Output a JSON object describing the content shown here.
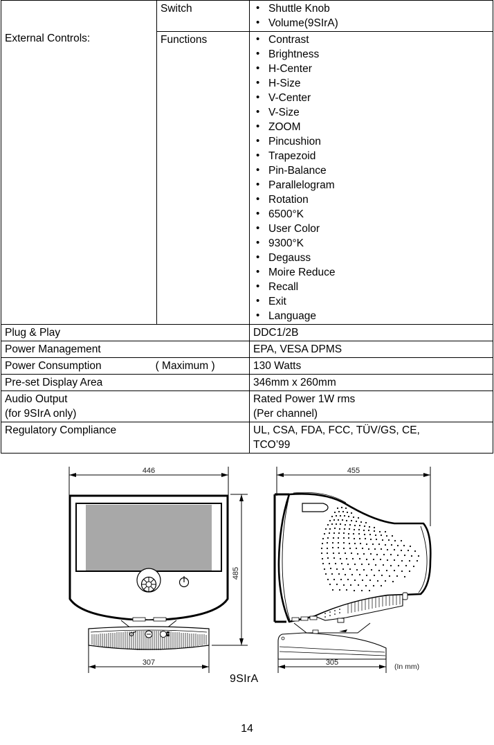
{
  "spec_table": {
    "rows": [
      {
        "label": "",
        "category": "Switch",
        "items": [
          "Shuttle Knob",
          "Volume(9SIrA)"
        ]
      },
      {
        "label": "External Controls:",
        "category": "Functions",
        "items": [
          "Contrast",
          "Brightness",
          "H-Center",
          "H-Size",
          "V-Center",
          "V-Size",
          "ZOOM",
          "Pincushion",
          "Trapezoid",
          "Pin-Balance",
          "Parallelogram",
          "Rotation",
          "6500°K",
          "User Color",
          "9300°K",
          "Degauss",
          "Moire Reduce",
          "Recall",
          "Exit",
          "Language"
        ]
      }
    ],
    "simple_rows": [
      {
        "name": "Plug & Play",
        "qualifier": "",
        "value": "DDC1/2B",
        "value2": ""
      },
      {
        "name": "Power Management",
        "qualifier": "",
        "value": "EPA, VESA DPMS",
        "value2": ""
      },
      {
        "name": "Power Consumption",
        "qualifier": "( Maximum )",
        "value": "130 Watts",
        "value2": ""
      },
      {
        "name": "Pre-set Display Area",
        "qualifier": "",
        "value": "346mm x 260mm",
        "value2": ""
      },
      {
        "name": "Audio Output",
        "qualifier": "",
        "name2": "(for 9SIrA only)",
        "value": "Rated Power 1W rms",
        "value2": "(Per channel)"
      },
      {
        "name": "Regulatory Compliance",
        "qualifier": "",
        "value": "UL, CSA, FDA, FCC, TÜV/GS, CE,",
        "value2": "TCO’99"
      }
    ]
  },
  "diagram": {
    "front_view": {
      "width_dim": "446",
      "height_dim": "485",
      "base_dim": "307"
    },
    "side_view": {
      "depth_dim": "455",
      "base_dim": "305"
    },
    "unit_note": "(In mm)",
    "model_label": "9SIrA",
    "screen_color": "#a8a8a8"
  },
  "page_number": "14"
}
